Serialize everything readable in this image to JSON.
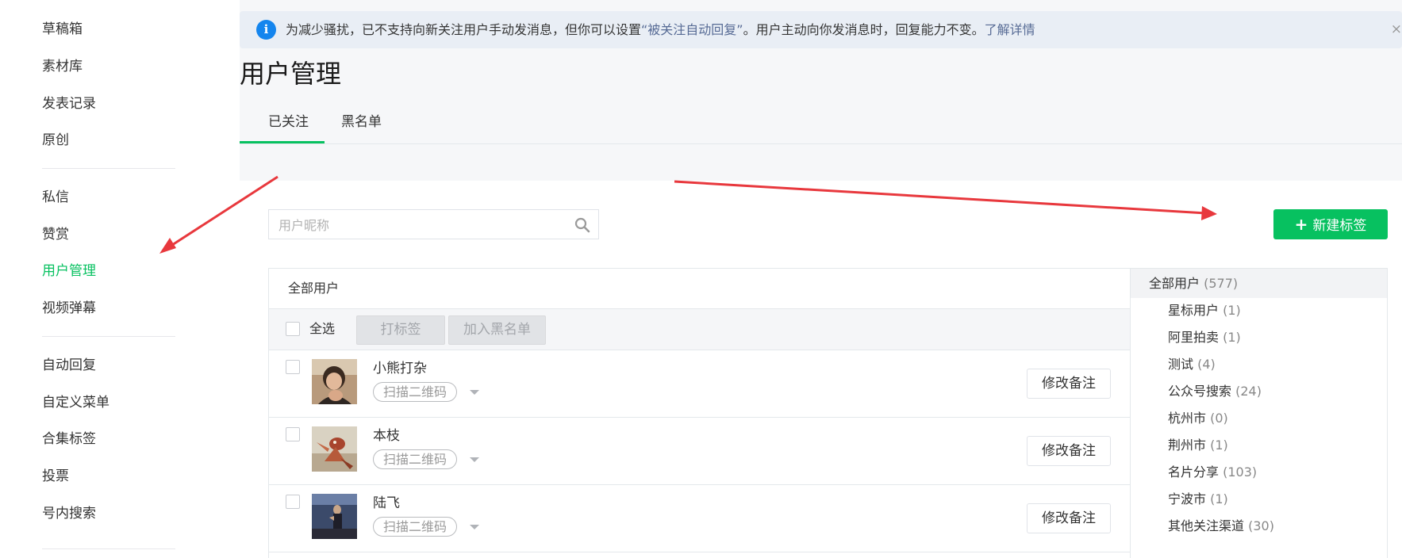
{
  "sidebar": {
    "group1": [
      "草稿箱",
      "素材库",
      "发表记录",
      "原创"
    ],
    "group2": [
      "私信",
      "赞赏",
      "用户管理",
      "视频弹幕"
    ],
    "group3": [
      "自动回复",
      "自定义菜单",
      "合集标签",
      "投票",
      "号内搜索"
    ],
    "active": "用户管理"
  },
  "notice": {
    "icon": "info-icon",
    "text_before": "为减少骚扰，已不支持向新关注用户手动发消息，但你可以设置",
    "link_reply": "“被关注自动回复”",
    "text_after": "。用户主动向你发消息时，回复能力不变。",
    "link_more": "了解详情",
    "close": "×"
  },
  "page_title": "用户管理",
  "tabs": [
    {
      "label": "已关注",
      "active": true
    },
    {
      "label": "黑名单",
      "active": false
    }
  ],
  "search": {
    "placeholder": "用户昵称",
    "value": ""
  },
  "new_tag_button": {
    "icon": "plus-icon",
    "label": "新建标签"
  },
  "table": {
    "title": "全部用户",
    "select_all_label": "全选",
    "tag_button": "打标签",
    "blacklist_button": "加入黑名单",
    "rows": [
      {
        "nickname": "小熊打杂",
        "source": "扫描二维码",
        "action": "修改备注",
        "avatar": "avatar-photo-person"
      },
      {
        "nickname": "本枝",
        "source": "扫描二维码",
        "action": "修改备注",
        "avatar": "avatar-cartoon-cat"
      },
      {
        "nickname": "陆飞",
        "source": "扫描二维码",
        "action": "修改备注",
        "avatar": "avatar-photo-dark"
      }
    ]
  },
  "tag_list": {
    "all": {
      "name": "全部用户",
      "count": "(577)"
    },
    "items": [
      {
        "name": "星标用户",
        "count": "(1)"
      },
      {
        "name": "阿里拍卖",
        "count": "(1)"
      },
      {
        "name": "测试",
        "count": "(4)"
      },
      {
        "name": "公众号搜索",
        "count": "(24)"
      },
      {
        "name": "杭州市",
        "count": "(0)"
      },
      {
        "name": "荆州市",
        "count": "(1)"
      },
      {
        "name": "名片分享",
        "count": "(103)"
      },
      {
        "name": "宁波市",
        "count": "(1)"
      },
      {
        "name": "其他关注渠道",
        "count": "(30)"
      }
    ]
  },
  "colors": {
    "accent": "#07c160",
    "annotation_arrow": "#e8383d",
    "link": "#576b95",
    "info": "#1485ee"
  }
}
